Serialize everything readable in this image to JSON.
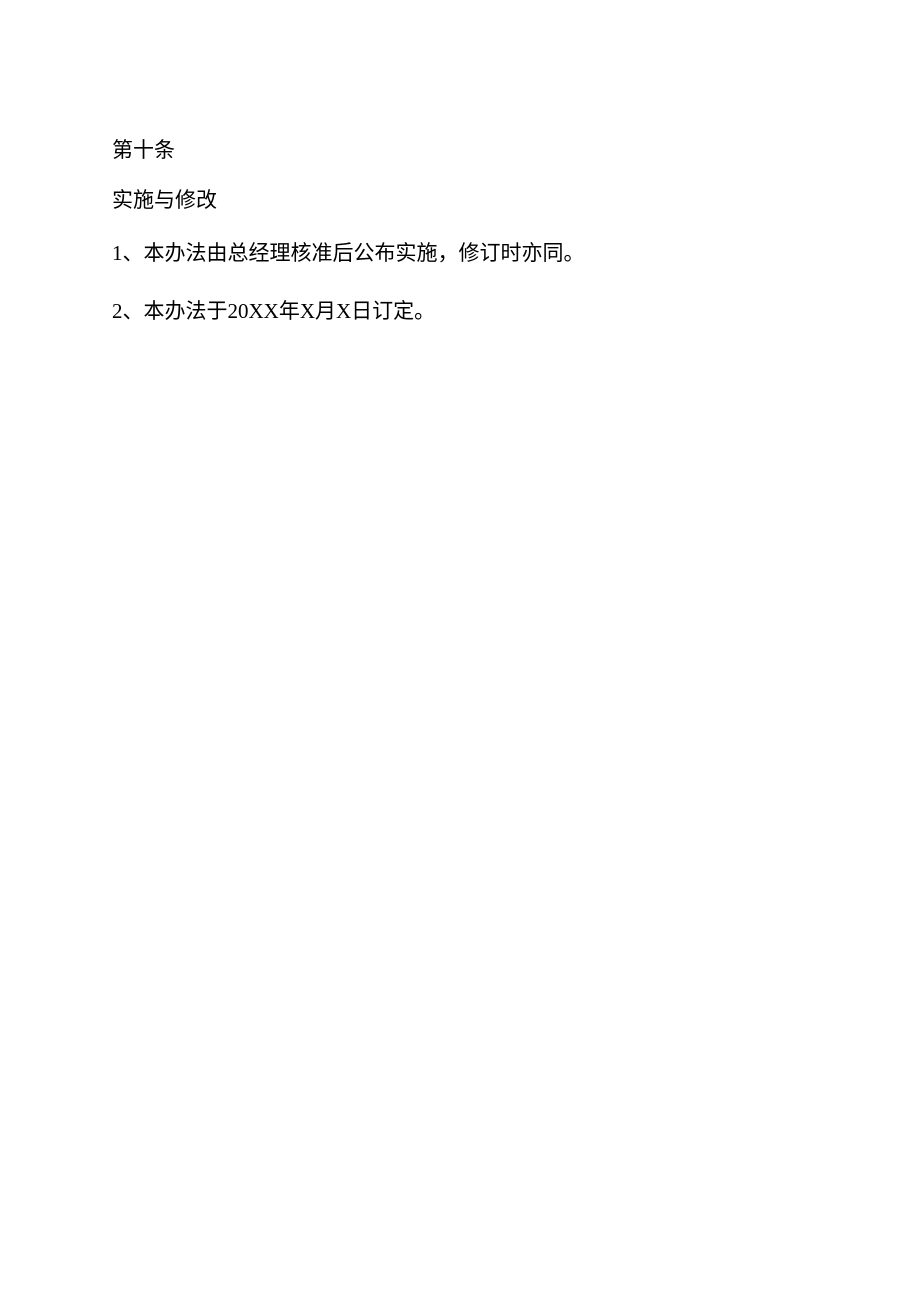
{
  "article": {
    "heading": "第十条",
    "section": "实施与修改",
    "items": [
      "1、本办法由总经理核准后公布实施，修订时亦同。",
      "2、本办法于20XX年X月X日订定。"
    ]
  }
}
